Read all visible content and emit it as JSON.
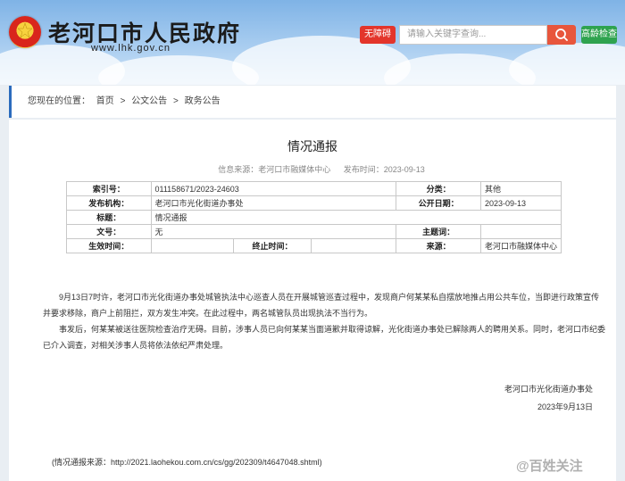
{
  "header": {
    "site_title": "老河口市人民政府",
    "site_url": "www.lhk.gov.cn",
    "accessible_label": "无障碍",
    "search_placeholder": "请输入关键字查询...",
    "elder_mode_label": "高龄检查"
  },
  "breadcrumb": {
    "prefix": "您现在的位置：",
    "items": [
      "首页",
      "公文公告",
      "政务公告"
    ],
    "separator": ">"
  },
  "article": {
    "title": "情况通报",
    "source": "信息来源：老河口市融媒体中心",
    "publish_time": "发布时间：2023-09-13"
  },
  "info_table": {
    "index_label": "索引号：",
    "index_value": "011158671/2023-24603",
    "category_label": "分类：",
    "category_value": "其他",
    "issuer_label": "发布机构：",
    "issuer_value": "老河口市光化街道办事处",
    "public_date_label": "公开日期：",
    "public_date_value": "2023-09-13",
    "title_label": "标题：",
    "title_value": "情况通报",
    "docnum_label": "文号：",
    "docnum_value": "无",
    "subject_label": "主题词：",
    "subject_value": "",
    "effective_label": "生效时间：",
    "effective_value": "",
    "expire_label": "终止时间：",
    "expire_value": "",
    "origin_label": "来源：",
    "origin_value": "老河口市融媒体中心"
  },
  "body": {
    "p1": "9月13日7时许，老河口市光化街道办事处城管执法中心巡查人员在开展城管巡查过程中，发现商户何某某私自摆放地推占用公共车位，当即进行政策宣传并要求移除，商户上前阻拦，双方发生冲突。在此过程中，两名城管队员出现执法不当行为。",
    "p2": "事发后，何某某被送往医院检查治疗无碍。目前，涉事人员已向何某某当面道歉并取得谅解，光化街道办事处已解除两人的聘用关系。同时，老河口市纪委已介入调查，对相关涉事人员将依法依纪严肃处理。",
    "signer": "老河口市光化街道办事处",
    "date": "2023年9月13日",
    "source_line": "(情况通报来源：http://2021.laohekou.com.cn/cs/gg/202309/t4647048.shtml)"
  },
  "watermark": "@百姓关注",
  "colors": {
    "accent_red": "#e3352b",
    "accent_green": "#2fa34f",
    "breadcrumb_bar": "#2b6bbd"
  }
}
